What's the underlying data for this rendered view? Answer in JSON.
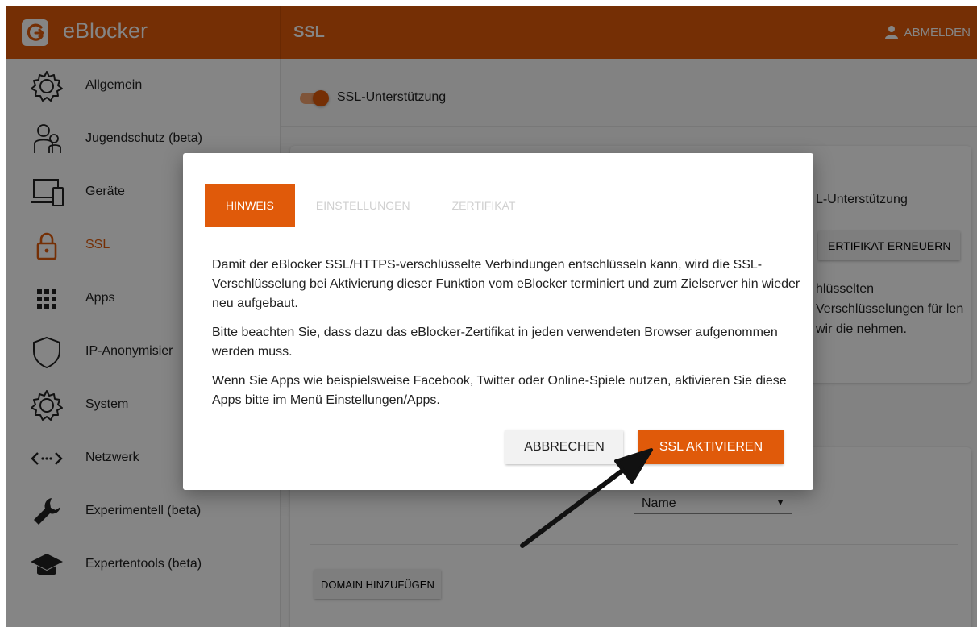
{
  "app": {
    "name": "eBlocker",
    "page_title": "SSL",
    "logout_label": "ABMELDEN"
  },
  "sidebar": {
    "items": [
      {
        "label": "Allgemein",
        "icon": "gear-icon"
      },
      {
        "label": "Jugendschutz (beta)",
        "icon": "family-icon"
      },
      {
        "label": "Geräte",
        "icon": "devices-icon"
      },
      {
        "label": "SSL",
        "icon": "lock-icon",
        "active": true
      },
      {
        "label": "Apps",
        "icon": "apps-grid-icon"
      },
      {
        "label": "IP-Anonymisier",
        "icon": "shield-icon"
      },
      {
        "label": "System",
        "icon": "gear-icon"
      },
      {
        "label": "Netzwerk",
        "icon": "network-icon"
      },
      {
        "label": "Experimentell (beta)",
        "icon": "wrench-icon"
      },
      {
        "label": "Expertentools (beta)",
        "icon": "graduation-cap-icon"
      }
    ]
  },
  "main": {
    "ssl_toggle_label": "SSL-Unterstützung",
    "ssl_toggle_on": true,
    "card1": {
      "title": "L-Unterstützung",
      "renew_button": "ERTIFIKAT ERNEUERN",
      "text": "hlüsselten Verschlüsselungen für len wir die nehmen."
    },
    "card2": {
      "sort_value": "Name",
      "add_domain_button": "DOMAIN HINZUFÜGEN"
    }
  },
  "dialog": {
    "tabs": [
      "HINWEIS",
      "EINSTELLUNGEN",
      "ZERTIFIKAT"
    ],
    "active_tab": 0,
    "paragraphs": [
      "Damit der eBlocker SSL/HTTPS-verschlüsselte Verbindungen entschlüsseln kann, wird die SSL-Verschlüsselung bei Aktivierung dieser Funktion vom eBlocker terminiert und zum Zielserver hin wieder neu aufgebaut.",
      "Bitte beachten Sie, dass dazu das eBlocker-Zertifikat in jeden verwendeten Browser aufgenommen werden muss.",
      "Wenn Sie Apps wie beispielsweise Facebook, Twitter oder Online-Spiele nutzen, aktivieren Sie diese Apps bitte im Menü Einstellungen/Apps."
    ],
    "cancel_label": "ABBRECHEN",
    "confirm_label": "SSL AKTIVIEREN"
  },
  "colors": {
    "accent": "#e05a0a",
    "overlay": "rgba(0,0,0,0.48)"
  }
}
